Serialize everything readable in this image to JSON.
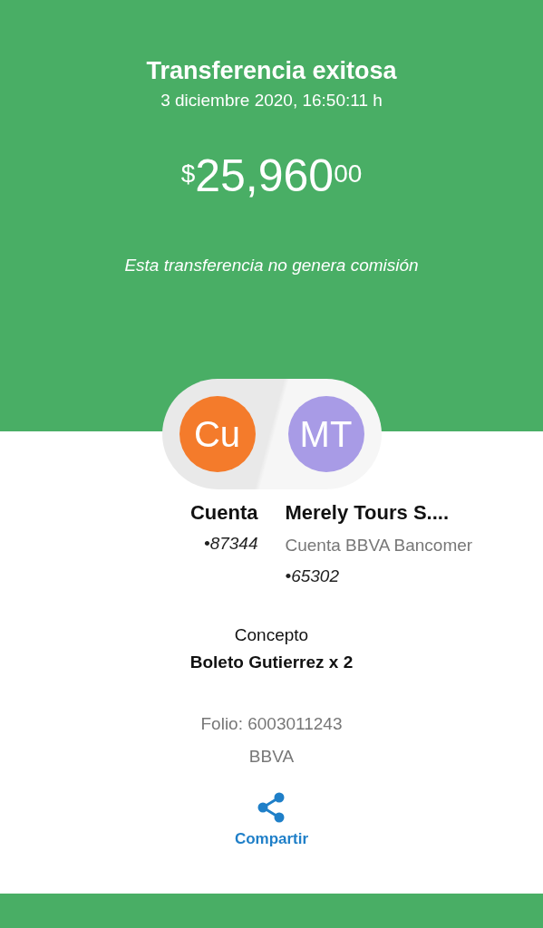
{
  "header": {
    "title": "Transferencia exitosa",
    "datetime": "3 diciembre 2020, 16:50:11 h",
    "amount": {
      "currency": "$",
      "whole": "25,960",
      "cents": "00"
    },
    "note": "Esta transferencia no genera comisión"
  },
  "parties": [
    {
      "initials": "Cu",
      "color": "#f47b2b",
      "name": "Cuenta",
      "account": "•87344"
    },
    {
      "initials": "MT",
      "color": "#a89be6",
      "name": "Merely Tours S....",
      "bank": "Cuenta BBVA Bancomer",
      "account": "•65302"
    }
  ],
  "concept": {
    "label": "Concepto",
    "value": "Boleto Gutierrez x 2"
  },
  "folio": "Folio: 6003011243",
  "bank": "BBVA",
  "share": {
    "label": "Compartir"
  }
}
